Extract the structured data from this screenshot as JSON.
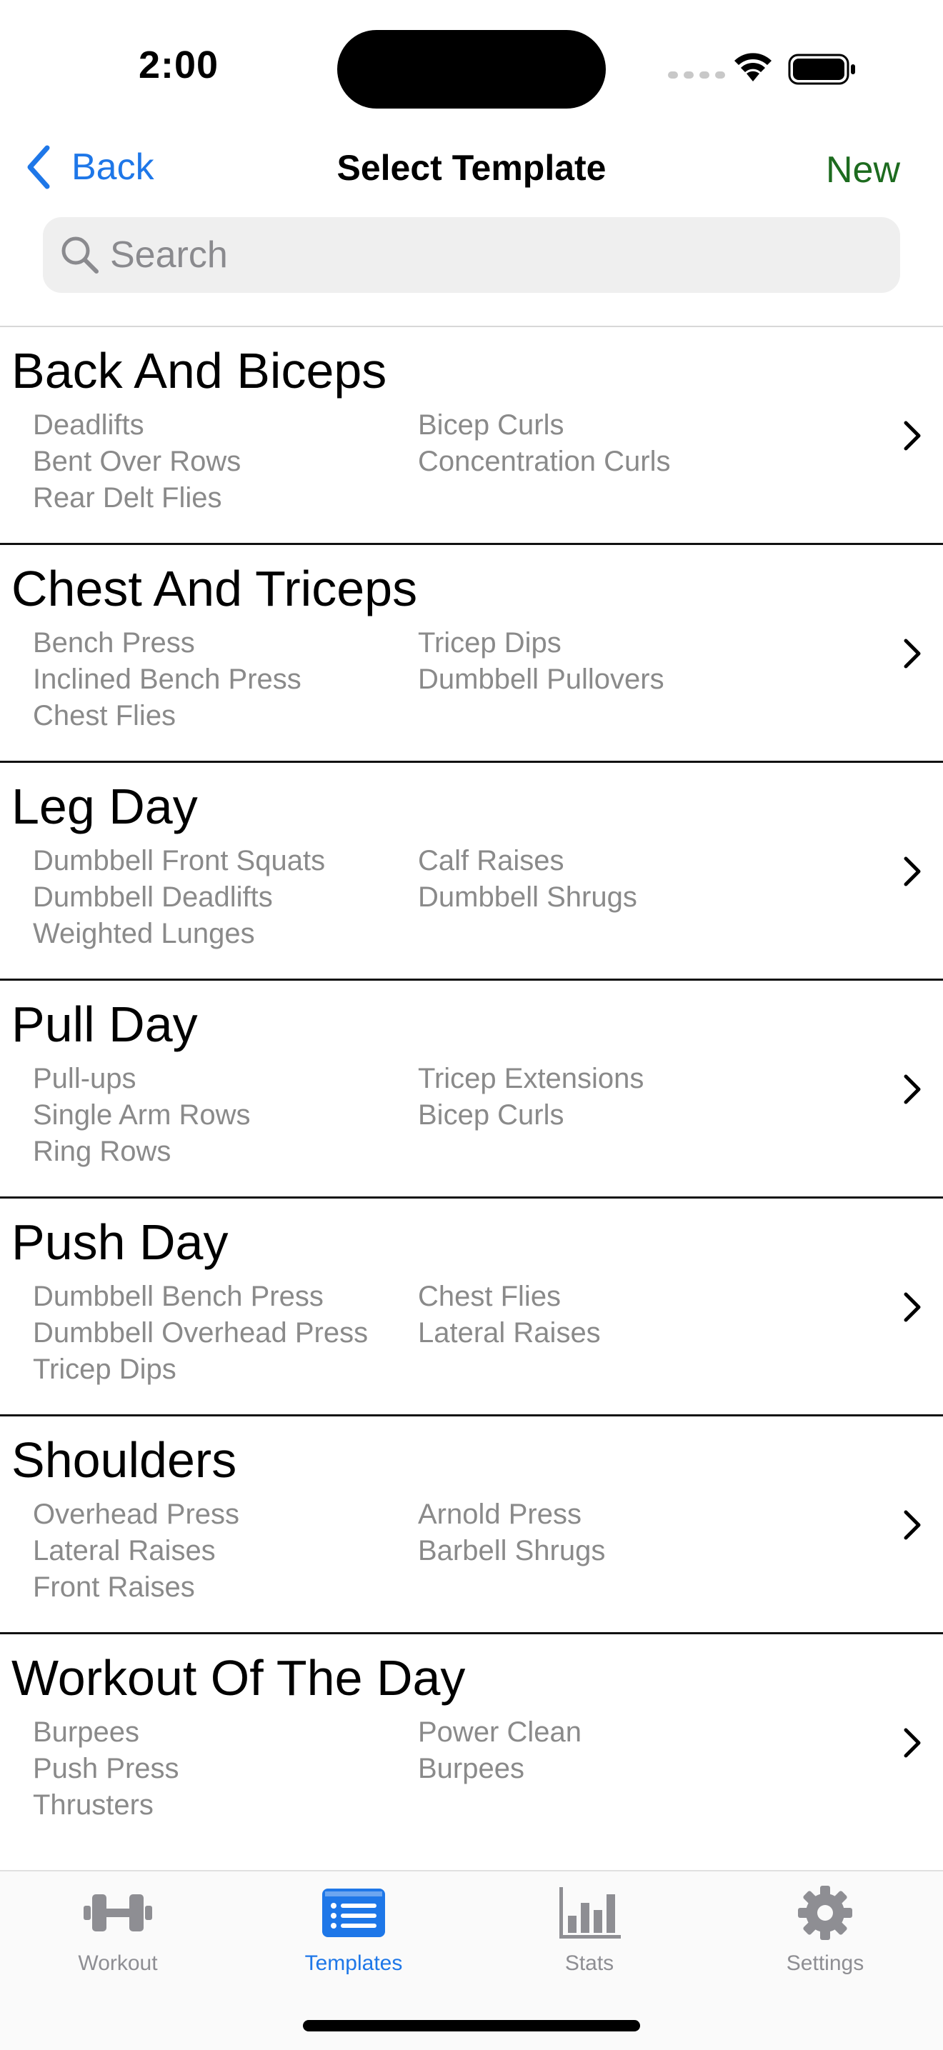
{
  "status_bar": {
    "time": "2:00"
  },
  "nav": {
    "back_label": "Back",
    "title": "Select Template",
    "new_label": "New"
  },
  "search": {
    "placeholder": "Search",
    "value": ""
  },
  "colors": {
    "accent_blue": "#1e77e8",
    "new_green": "#1d6b1f",
    "secondary_text": "#8a8a8a"
  },
  "templates": [
    {
      "name": "Back And Biceps",
      "exercises_left": [
        "Deadlifts",
        "Bent Over Rows",
        "Rear Delt Flies"
      ],
      "exercises_right": [
        "Bicep Curls",
        "Concentration Curls"
      ]
    },
    {
      "name": "Chest And Triceps",
      "exercises_left": [
        "Bench Press",
        "Inclined Bench Press",
        "Chest Flies"
      ],
      "exercises_right": [
        "Tricep Dips",
        "Dumbbell Pullovers"
      ]
    },
    {
      "name": "Leg Day",
      "exercises_left": [
        "Dumbbell Front Squats",
        "Dumbbell Deadlifts",
        "Weighted Lunges"
      ],
      "exercises_right": [
        "Calf Raises",
        "Dumbbell Shrugs"
      ]
    },
    {
      "name": "Pull Day",
      "exercises_left": [
        "Pull-ups",
        "Single Arm Rows",
        "Ring Rows"
      ],
      "exercises_right": [
        "Tricep Extensions",
        "Bicep Curls"
      ]
    },
    {
      "name": "Push Day",
      "exercises_left": [
        "Dumbbell Bench Press",
        "Dumbbell Overhead Press",
        "Tricep Dips"
      ],
      "exercises_right": [
        "Chest Flies",
        "Lateral Raises"
      ]
    },
    {
      "name": "Shoulders",
      "exercises_left": [
        "Overhead Press",
        "Lateral Raises",
        "Front Raises"
      ],
      "exercises_right": [
        "Arnold Press",
        "Barbell Shrugs"
      ]
    },
    {
      "name": "Workout Of The Day",
      "exercises_left": [
        "Burpees",
        "Push Press",
        "Thrusters"
      ],
      "exercises_right": [
        "Power Clean",
        "Burpees"
      ]
    }
  ],
  "tabs": [
    {
      "label": "Workout",
      "icon": "dumbbell-icon",
      "active": false
    },
    {
      "label": "Templates",
      "icon": "list-icon",
      "active": true
    },
    {
      "label": "Stats",
      "icon": "bar-chart-icon",
      "active": false
    },
    {
      "label": "Settings",
      "icon": "gear-icon",
      "active": false
    }
  ]
}
